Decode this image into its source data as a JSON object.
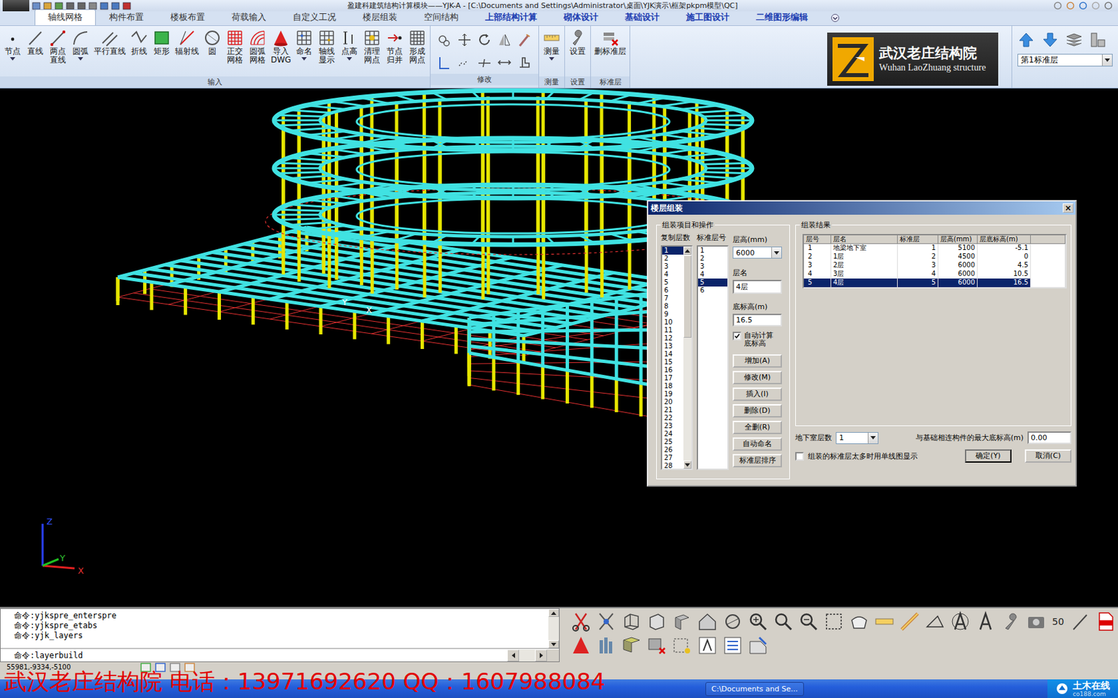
{
  "window": {
    "title": "盈建科建筑结构计算模块——YJK-A - [C:\\Documents and Settings\\Administrator\\桌面\\YJK演示\\框架pkpm模型\\QC]"
  },
  "tabs": [
    {
      "label": "轴线网格",
      "selected": true,
      "kind": "tab"
    },
    {
      "label": "构件布置",
      "selected": false,
      "kind": "tab"
    },
    {
      "label": "楼板布置",
      "selected": false,
      "kind": "tab"
    },
    {
      "label": "荷载输入",
      "selected": false,
      "kind": "tab"
    },
    {
      "label": "自定义工况",
      "selected": false,
      "kind": "tab"
    },
    {
      "label": "楼层组装",
      "selected": false,
      "kind": "tab"
    },
    {
      "label": "空间结构",
      "selected": false,
      "kind": "tab"
    },
    {
      "label": "上部结构计算",
      "selected": false,
      "kind": "module"
    },
    {
      "label": "砌体设计",
      "selected": false,
      "kind": "module"
    },
    {
      "label": "基础设计",
      "selected": false,
      "kind": "module"
    },
    {
      "label": "施工图设计",
      "selected": false,
      "kind": "module"
    },
    {
      "label": "二维图形编辑",
      "selected": false,
      "kind": "module"
    }
  ],
  "ribbon": {
    "groups": [
      {
        "label": "输入",
        "kind": "large",
        "tools": [
          {
            "lines": [
              "节点"
            ],
            "has_menu": true
          },
          {
            "lines": [
              "直线"
            ],
            "has_menu": false
          },
          {
            "lines": [
              "两点",
              "直线"
            ],
            "has_menu": false
          },
          {
            "lines": [
              "圆弧"
            ],
            "has_menu": true
          },
          {
            "lines": [
              "平行直线"
            ],
            "has_menu": false
          },
          {
            "lines": [
              "折线"
            ],
            "has_menu": false
          },
          {
            "lines": [
              "矩形"
            ],
            "has_menu": false
          },
          {
            "lines": [
              "辐射线"
            ],
            "has_menu": false
          },
          {
            "lines": [
              "圆"
            ],
            "has_menu": false
          },
          {
            "lines": [
              "正交",
              "网格"
            ],
            "has_menu": false
          },
          {
            "lines": [
              "圆弧",
              "网格"
            ],
            "has_menu": false
          },
          {
            "lines": [
              "导入",
              "DWG"
            ],
            "has_menu": false
          },
          {
            "lines": [
              "命名"
            ],
            "has_menu": true
          },
          {
            "lines": [
              "轴线",
              "显示"
            ],
            "has_menu": false
          },
          {
            "lines": [
              "点高"
            ],
            "has_menu": true
          },
          {
            "lines": [
              "清理",
              "网点"
            ],
            "has_menu": false
          },
          {
            "lines": [
              "节点",
              "归并"
            ],
            "has_menu": false
          },
          {
            "lines": [
              "形成",
              "网点"
            ],
            "has_menu": false
          }
        ]
      },
      {
        "label": "修改",
        "kind": "small",
        "tools": []
      },
      {
        "label": "测量",
        "kind": "large",
        "tools": [
          {
            "lines": [
              "测量"
            ],
            "has_menu": true
          }
        ]
      },
      {
        "label": "设置",
        "kind": "large",
        "tools": [
          {
            "lines": [
              "设置"
            ],
            "has_menu": false
          }
        ]
      },
      {
        "label": "标准层",
        "kind": "large",
        "tools": [
          {
            "lines": [
              "删标准层"
            ],
            "has_menu": false
          }
        ]
      }
    ]
  },
  "brand": {
    "cn": "武汉老庄结构院",
    "en": "Wuhan LaoZhuang structure"
  },
  "layer_select": {
    "value": "第1标准层"
  },
  "viewport": {
    "model_labels": [
      "Y",
      "X"
    ],
    "axis": {
      "z": "Z",
      "y": "Y",
      "x": "X"
    }
  },
  "dialog": {
    "title": "楼层组装",
    "close": "×",
    "ops": {
      "title": "组装项目和操作",
      "copy_label": "复制层数",
      "copy_items": [
        {
          "label": "1",
          "selected": true
        },
        {
          "label": "2",
          "selected": false
        },
        {
          "label": "3",
          "selected": false
        },
        {
          "label": "4",
          "selected": false
        },
        {
          "label": "5",
          "selected": false
        },
        {
          "label": "6",
          "selected": false
        },
        {
          "label": "7",
          "selected": false
        },
        {
          "label": "8",
          "selected": false
        },
        {
          "label": "9",
          "selected": false
        },
        {
          "label": "10",
          "selected": false
        },
        {
          "label": "11",
          "selected": false
        },
        {
          "label": "12",
          "selected": false
        },
        {
          "label": "13",
          "selected": false
        },
        {
          "label": "14",
          "selected": false
        },
        {
          "label": "15",
          "selected": false
        },
        {
          "label": "16",
          "selected": false
        },
        {
          "label": "17",
          "selected": false
        },
        {
          "label": "18",
          "selected": false
        },
        {
          "label": "19",
          "selected": false
        },
        {
          "label": "20",
          "selected": false
        },
        {
          "label": "21",
          "selected": false
        },
        {
          "label": "22",
          "selected": false
        },
        {
          "label": "23",
          "selected": false
        },
        {
          "label": "24",
          "selected": false
        },
        {
          "label": "25",
          "selected": false
        },
        {
          "label": "26",
          "selected": false
        },
        {
          "label": "27",
          "selected": false
        },
        {
          "label": "28",
          "selected": false
        }
      ],
      "std_label": "标准层号",
      "std_items": [
        {
          "label": "1",
          "selected": false
        },
        {
          "label": "2",
          "selected": false
        },
        {
          "label": "3",
          "selected": false
        },
        {
          "label": "4",
          "selected": false
        },
        {
          "label": "5",
          "selected": true
        },
        {
          "label": "6",
          "selected": false
        }
      ],
      "height_label": "层高(mm)",
      "height_value": "6000",
      "name_label": "层名",
      "name_value": "4层",
      "base_label": "底标高(m)",
      "base_value": "16.5",
      "auto": {
        "label": "自动计算底标高",
        "checked": true
      },
      "buttons": [
        "增加(A)",
        "修改(M)",
        "插入(I)",
        "删除(D)",
        "全删(R)",
        "自动命名",
        "标准层排序"
      ]
    },
    "result": {
      "title": "组装结果",
      "columns": [
        "层号",
        "层名",
        "标准层",
        "层高(mm)",
        "层底标高(m)"
      ],
      "rows": [
        {
          "cells": [
            "1",
            "地梁地下室",
            "1",
            "5100",
            "-5.1"
          ],
          "selected": false
        },
        {
          "cells": [
            "2",
            "1层",
            "2",
            "4500",
            "0"
          ],
          "selected": false
        },
        {
          "cells": [
            "3",
            "2层",
            "3",
            "6000",
            "4.5"
          ],
          "selected": false
        },
        {
          "cells": [
            "4",
            "3层",
            "4",
            "6000",
            "10.5"
          ],
          "selected": false
        },
        {
          "cells": [
            "5",
            "4层",
            "5",
            "6000",
            "16.5"
          ],
          "selected": true
        }
      ]
    },
    "basement_label": "地下室层数",
    "basement_value": "1",
    "max_base_label": "与基础相连构件的最大底标高(m)",
    "max_base_value": "0.00",
    "single_line": {
      "label": "组装的标准层太多时用单线图显示",
      "checked": false
    },
    "ok": "确定(Y)",
    "cancel": "取消(C)"
  },
  "command": {
    "lines": [
      "命令:yjkspre_enterspre",
      "命令:yjkspre_etabs",
      "命令:yjk_layers"
    ],
    "prompt": "命令:layerbuild"
  },
  "toolbar_label": "50",
  "status": {
    "coords": "55981,-9334,-5100"
  },
  "watermark": "武汉老庄结构院 电话：13971692620 QQ：1607988084",
  "taskbar": {
    "items": [
      "C:\\Documents and Se..."
    ]
  },
  "site_logo": {
    "text": "土木在线",
    "domain": "co188.com"
  }
}
